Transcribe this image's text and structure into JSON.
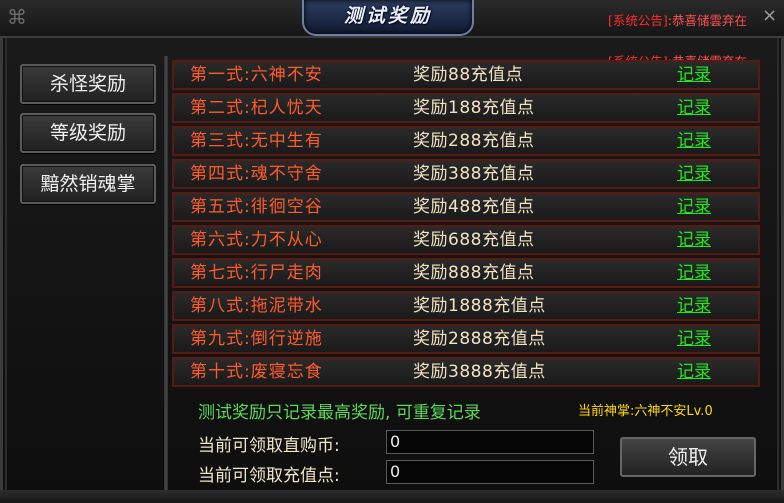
{
  "window": {
    "title": "测试奖励",
    "close_glyph": "×"
  },
  "notices": [
    {
      "tag": "[系统公告]",
      "text": ":恭喜储雲弃在"
    },
    {
      "tag": "[系统公告]",
      "text": ":恭喜储雲弃在"
    }
  ],
  "sidebar": {
    "items": [
      {
        "label": "杀怪奖励"
      },
      {
        "label": "等级奖励"
      },
      {
        "label": "黯然销魂掌"
      }
    ]
  },
  "rewards": [
    {
      "name": "第一式:六神不安",
      "reward": "奖励88充值点",
      "record": "记录"
    },
    {
      "name": "第二式:杞人忧天",
      "reward": "奖励188充值点",
      "record": "记录"
    },
    {
      "name": "第三式:无中生有",
      "reward": "奖励288充值点",
      "record": "记录"
    },
    {
      "name": "第四式:魂不守舍",
      "reward": "奖励388充值点",
      "record": "记录"
    },
    {
      "name": "第五式:徘徊空谷",
      "reward": "奖励488充值点",
      "record": "记录"
    },
    {
      "name": "第六式:力不从心",
      "reward": "奖励688充值点",
      "record": "记录"
    },
    {
      "name": "第七式:行尸走肉",
      "reward": "奖励888充值点",
      "record": "记录"
    },
    {
      "name": "第八式:拖泥带水",
      "reward": "奖励1888充值点",
      "record": "记录"
    },
    {
      "name": "第九式:倒行逆施",
      "reward": "奖励2888充值点",
      "record": "记录"
    },
    {
      "name": "第十式:废寝忘食",
      "reward": "奖励3888充值点",
      "record": "记录"
    }
  ],
  "footer": {
    "info": "测试奖励只记录最高奖励, 可重复记录",
    "current_skill": "当前神掌:六神不安Lv.0",
    "direct_coin_label": "当前可领取直购币:",
    "direct_coin_value": "0",
    "recharge_label": "当前可领取充值点:",
    "recharge_value": "0",
    "claim_label": "领取"
  },
  "colors": {
    "row_name": "#ff5a2a",
    "row_reward": "#f4e3c3",
    "record_link": "#23e81c",
    "info_text": "#5cd85c",
    "level_text": "#ffd800",
    "notice_text": "#ff2a2a"
  }
}
